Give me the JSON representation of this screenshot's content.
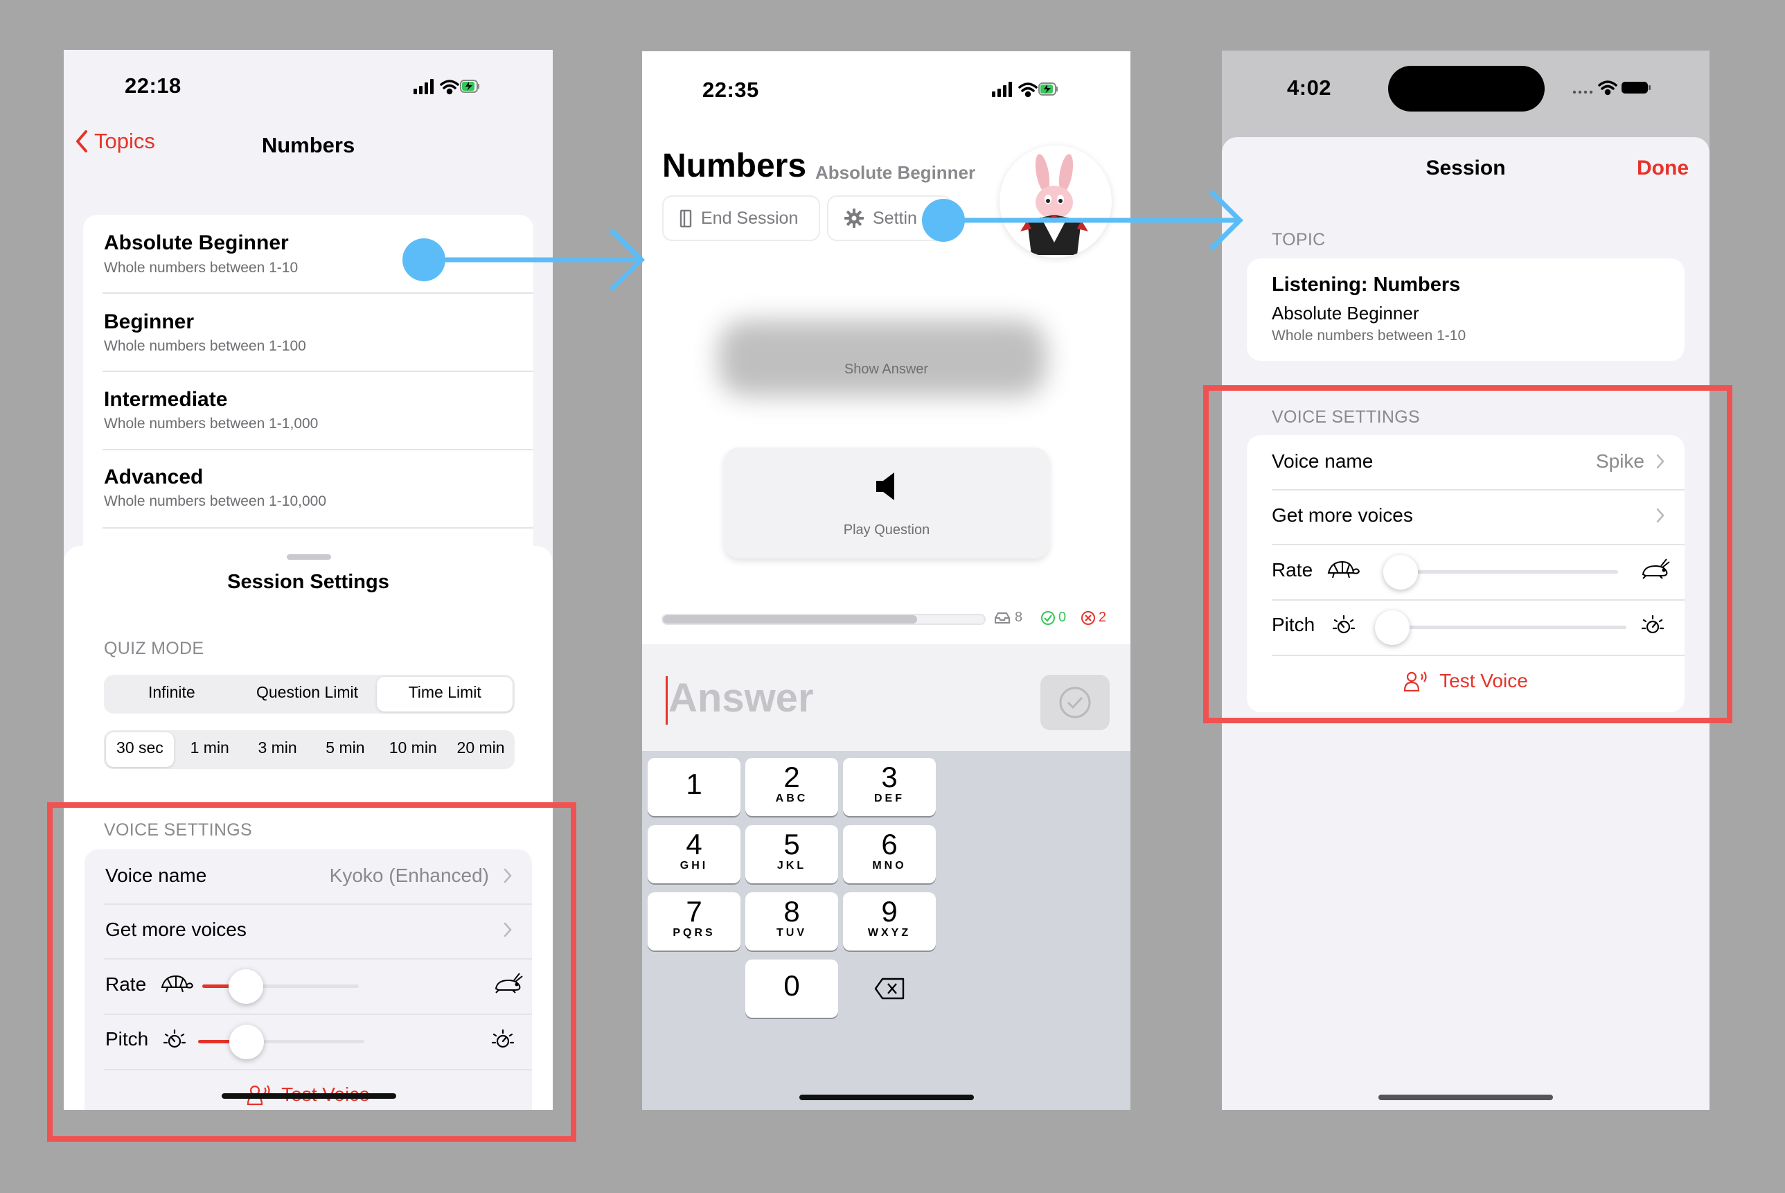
{
  "screen1": {
    "status": {
      "time": "22:18"
    },
    "nav": {
      "back_label": "Topics",
      "title": "Numbers"
    },
    "levels": [
      {
        "title": "Absolute Beginner",
        "subtitle": "Whole numbers between 1-10"
      },
      {
        "title": "Beginner",
        "subtitle": "Whole numbers between 1-100"
      },
      {
        "title": "Intermediate",
        "subtitle": "Whole numbers between 1-1,000"
      },
      {
        "title": "Advanced",
        "subtitle": "Whole numbers between 1-10,000"
      }
    ],
    "sheet": {
      "title": "Session Settings",
      "quiz_mode_header": "QUIZ MODE",
      "modes": [
        "Infinite",
        "Question Limit",
        "Time Limit"
      ],
      "selected_mode": "Time Limit",
      "durations": [
        "30 sec",
        "1 min",
        "3 min",
        "5 min",
        "10 min",
        "20 min"
      ],
      "selected_duration": "30 sec",
      "voice_header": "VOICE SETTINGS",
      "voice_name_label": "Voice name",
      "voice_name_value": "Kyoko (Enhanced)",
      "more_voices_label": "Get more voices",
      "rate_label": "Rate",
      "rate_value": 0.28,
      "pitch_label": "Pitch",
      "pitch_value": 0.29,
      "test_voice_label": "Test Voice"
    }
  },
  "screen2": {
    "status": {
      "time": "22:35"
    },
    "title": "Numbers",
    "subtitle": "Absolute Beginner",
    "end_session_label": "End Session",
    "settings_label": "Settin",
    "show_answer_label": "Show Answer",
    "play_question_label": "Play Question",
    "progress": 0.79,
    "stats": {
      "remaining": "8",
      "correct": "0",
      "wrong": "2"
    },
    "answer_placeholder": "Answer",
    "keys": [
      {
        "num": "1",
        "letters": ""
      },
      {
        "num": "2",
        "letters": "ABC"
      },
      {
        "num": "3",
        "letters": "DEF"
      },
      {
        "num": "4",
        "letters": "GHI"
      },
      {
        "num": "5",
        "letters": "JKL"
      },
      {
        "num": "6",
        "letters": "MNO"
      },
      {
        "num": "7",
        "letters": "PQRS"
      },
      {
        "num": "8",
        "letters": "TUV"
      },
      {
        "num": "9",
        "letters": "WXYZ"
      },
      {
        "num": "0",
        "letters": ""
      }
    ]
  },
  "screen3": {
    "status": {
      "time": "4:02"
    },
    "header": {
      "title": "Session",
      "done_label": "Done"
    },
    "topic_header": "TOPIC",
    "topic": {
      "title": "Listening: Numbers",
      "level": "Absolute Beginner",
      "description": "Whole numbers between 1-10"
    },
    "voice_header": "VOICE SETTINGS",
    "voice_name_label": "Voice name",
    "voice_name_value": "Spike",
    "more_voices_label": "Get more voices",
    "rate_label": "Rate",
    "rate_value": 0.0,
    "pitch_label": "Pitch",
    "pitch_value": 0.0,
    "test_voice_label": "Test Voice"
  },
  "colors": {
    "accent_red": "#e5332a",
    "arrow_blue": "#5bbcf7",
    "highlight_box": "#f05252",
    "background": "#a6a6a6"
  }
}
